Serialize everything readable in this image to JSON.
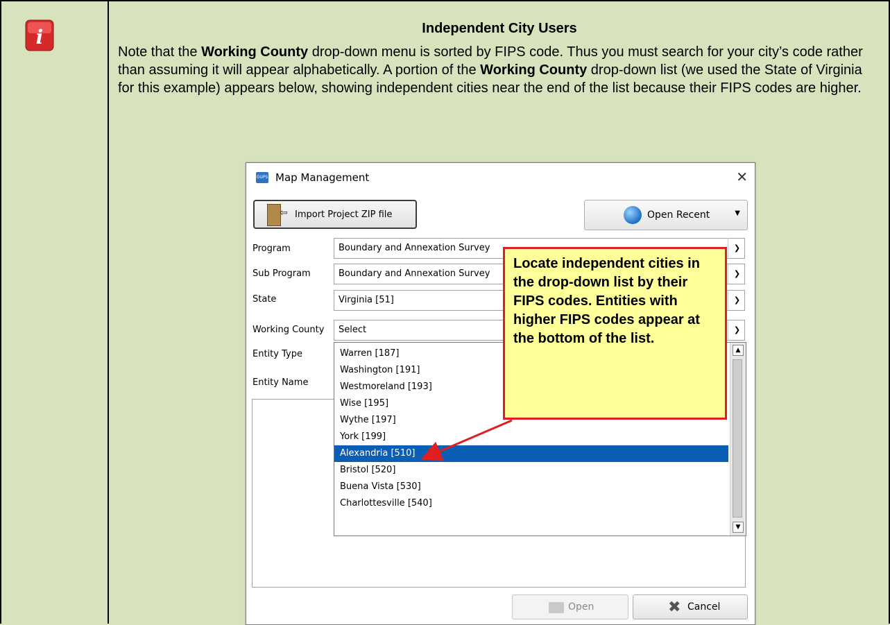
{
  "note": {
    "heading": "Independent City Users",
    "p1_a": "Note that the ",
    "p1_b1": "Working County",
    "p1_c": " drop-down menu is sorted by FIPS code. Thus you must search for your city’s code rather than assuming it will appear alphabetically. A portion of the ",
    "p1_b2": "Working County",
    "p1_d": " drop-down list (we used the State of Virginia for this example) appears below, showing independent cities near the end of the list because their FIPS codes are higher."
  },
  "dialog": {
    "title": "Map Management",
    "import_label": "Import Project ZIP file",
    "recent_label": "Open Recent",
    "labels": {
      "program": "Program",
      "sub_program": "Sub Program",
      "state": "State",
      "working_county": "Working County",
      "entity_type": "Entity Type",
      "entity_name": "Entity Name"
    },
    "values": {
      "program": "Boundary and Annexation Survey",
      "sub_program": "Boundary and Annexation Survey",
      "state": "Virginia [51]",
      "working_county": "Select"
    },
    "dropdown_items": [
      "Warren [187]",
      "Washington [191]",
      "Westmoreland [193]",
      "Wise [195]",
      "Wythe [197]",
      "York [199]",
      "Alexandria [510]",
      "Bristol [520]",
      "Buena Vista [530]",
      "Charlottesville [540]"
    ],
    "selected_item": "Alexandria [510]",
    "open_label": "Open",
    "cancel_label": "Cancel"
  },
  "callout": {
    "text": "Locate independent cities in the drop-down list by their FIPS codes. Entities with higher FIPS codes appear at the bottom of the list."
  },
  "colors": {
    "background": "#d6e3bc",
    "selection": "#0a5fb4",
    "callout_fill": "#ffff99",
    "callout_border": "#e02020"
  }
}
